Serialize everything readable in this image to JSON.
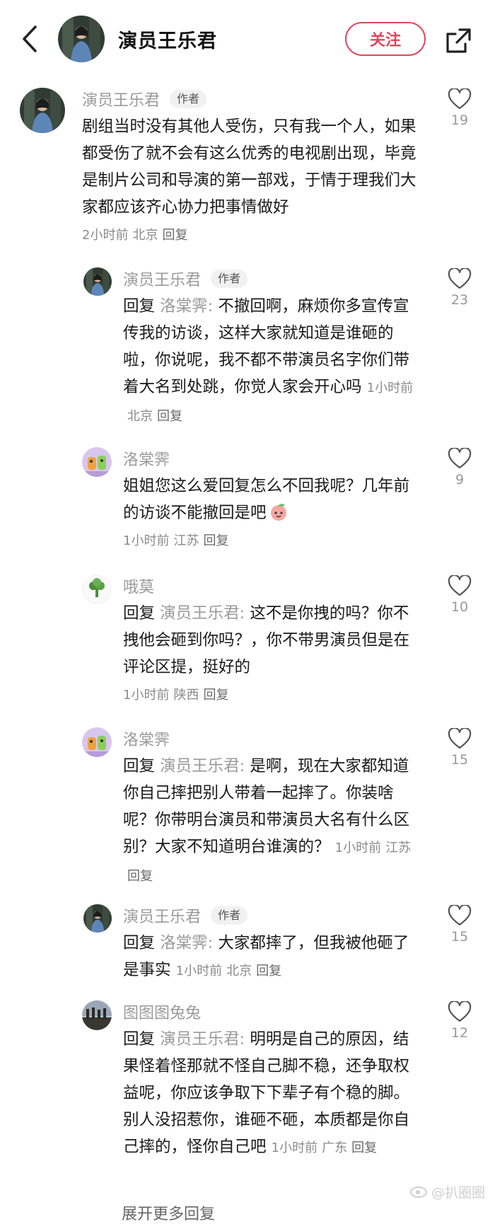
{
  "header": {
    "title": "演员王乐君",
    "follow_label": "关注",
    "back_icon": "chevron-left-icon",
    "share_icon": "share-icon"
  },
  "colors": {
    "accent": "#e0475b",
    "meta": "#8a8a8a",
    "author": "#9a9a9a"
  },
  "comments": [
    {
      "author": "演员王乐君",
      "tag": "作者",
      "text": "剧组当时没有其他人受伤，只有我一个人，如果都受伤了就不会有这么优秀的电视剧出现，毕竟是制片公司和导演的第一部戏，于情于理我们大家都应该齐心协力把事情做好",
      "time": "2小时前",
      "location": "北京",
      "reply_label": "回复",
      "likes": "19"
    },
    {
      "author": "演员王乐君",
      "tag": "作者",
      "reply_prefix": "回复",
      "reply_to": "洛棠霁:",
      "text": " 不撤回啊，麻烦你多宣传宣传我的访谈，这样大家就知道是谁砸的啦，你说呢，我不都不带演员名字你们带着大名到处跳，你觉人家会开心吗",
      "time": "1小时前",
      "location": "北京",
      "reply_label": "回复",
      "likes": "23"
    },
    {
      "author": "洛棠霁",
      "text": "姐姐您这么爱回复怎么不回我呢？几年前的访谈不能撤回是吧",
      "time": "1小时前",
      "location": "江苏",
      "reply_label": "回复",
      "likes": "9"
    },
    {
      "author": "哦莫",
      "reply_prefix": "回复",
      "reply_to": "演员王乐君:",
      "text": " 这不是你拽的吗？你不拽他会砸到你吗？，你不带男演员但是在评论区提，挺好的",
      "time": "1小时前",
      "location": "陕西",
      "reply_label": "回复",
      "likes": "10"
    },
    {
      "author": "洛棠霁",
      "reply_prefix": "回复",
      "reply_to": "演员王乐君:",
      "text": " 是啊，现在大家都知道你自己摔把别人带着一起摔了。你装啥呢？你带明台演员和带演员大名有什么区别？大家不知道明台谁演的？",
      "time": "1小时前",
      "location": "江苏",
      "reply_label": "回复",
      "likes": "15"
    },
    {
      "author": "演员王乐君",
      "tag": "作者",
      "reply_prefix": "回复",
      "reply_to": "洛棠霁:",
      "text": " 大家都摔了，但我被他砸了是事实",
      "time": "1小时前",
      "location": "北京",
      "reply_label": "回复",
      "likes": "15"
    },
    {
      "author": "图图图兔兔",
      "reply_prefix": "回复",
      "reply_to": "演员王乐君:",
      "text": " 明明是自己的原因，结果怪着怪那就不怪自己脚不稳，还争取权益呢，你应该争取下下辈子有个稳的脚。别人没招惹你，谁砸不砸，本质都是你自己摔的，怪你自己吧",
      "time": "1小时前",
      "location": "广东",
      "reply_label": "回复",
      "likes": "12"
    }
  ],
  "more_replies": "展开更多回复",
  "watermark": "@扒圈圈"
}
